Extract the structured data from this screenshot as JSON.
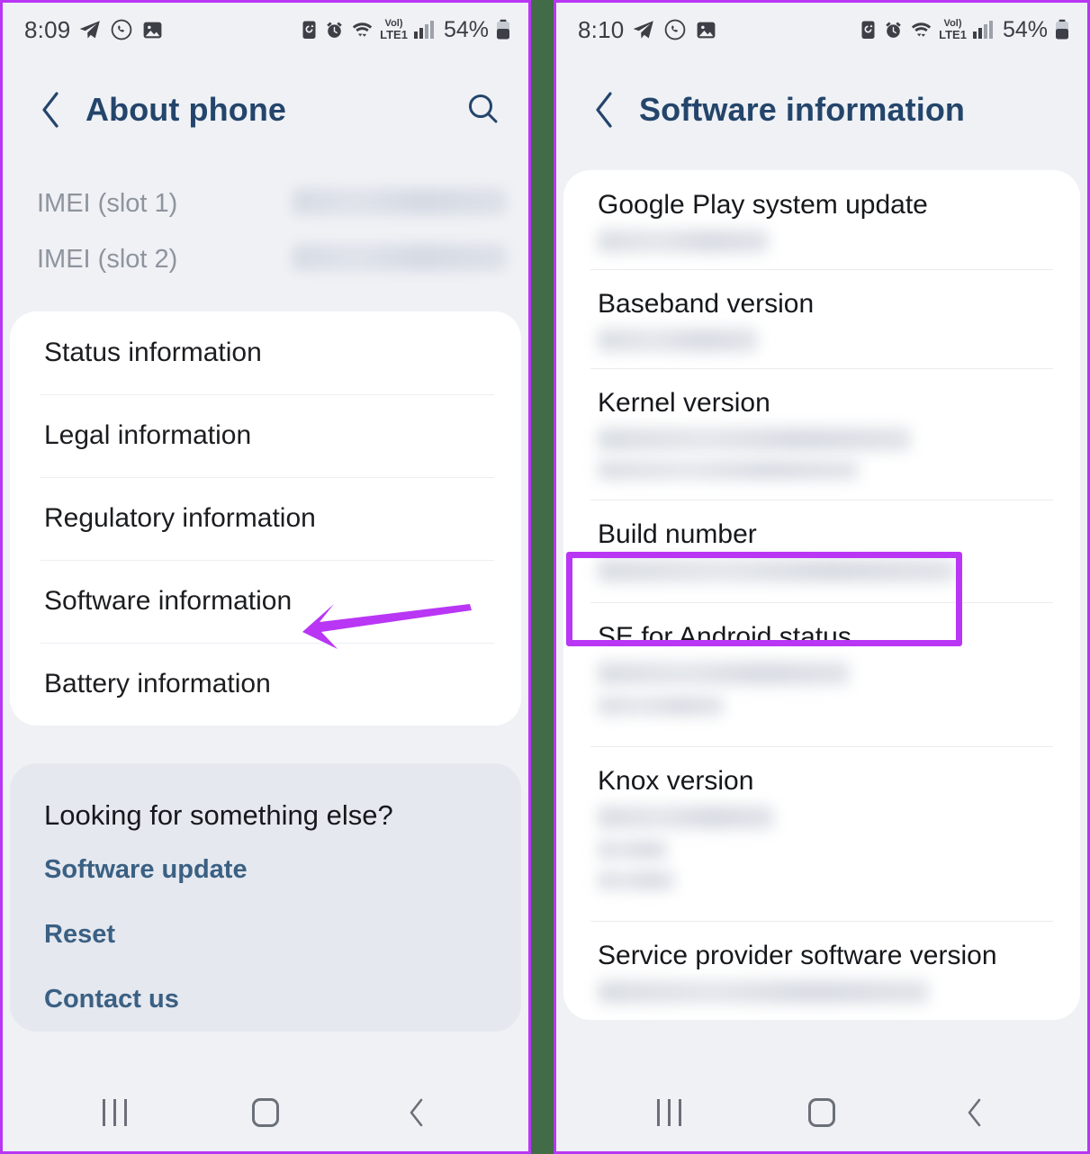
{
  "left_phone": {
    "status_bar": {
      "time": "8:09",
      "battery_percent": "54%",
      "network_label": "LTE1",
      "volte_label": "Vol)",
      "icons": [
        "telegram-icon",
        "whatsapp-icon",
        "gallery-icon",
        "battery-saver-icon",
        "alarm-icon",
        "wifi-icon",
        "volte-icon",
        "signal-bars-icon",
        "battery-icon"
      ]
    },
    "header": {
      "title": "About phone",
      "back_icon": "back-chevron-icon",
      "search_icon": "search-icon"
    },
    "imei": [
      {
        "label": "IMEI (slot 1)",
        "value": ""
      },
      {
        "label": "IMEI (slot 2)",
        "value": ""
      }
    ],
    "menu_items": [
      {
        "label": "Status information"
      },
      {
        "label": "Legal information"
      },
      {
        "label": "Regulatory information"
      },
      {
        "label": "Software information"
      },
      {
        "label": "Battery information"
      }
    ],
    "looking_for": {
      "title": "Looking for something else?",
      "links": [
        {
          "label": "Software update"
        },
        {
          "label": "Reset"
        },
        {
          "label": "Contact us"
        }
      ]
    },
    "nav_bar": {
      "recents_icon": "recents-icon",
      "home_icon": "home-icon",
      "back_icon": "back-icon"
    }
  },
  "right_phone": {
    "status_bar": {
      "time": "8:10",
      "battery_percent": "54%",
      "network_label": "LTE1",
      "volte_label": "Vol)"
    },
    "header": {
      "title": "Software information",
      "back_icon": "back-chevron-icon"
    },
    "info_rows": [
      {
        "label": "Google Play system update",
        "value": ""
      },
      {
        "label": "Baseband version",
        "value": ""
      },
      {
        "label": "Kernel version",
        "value": ""
      },
      {
        "label": "Build number",
        "value": "",
        "highlighted": true
      },
      {
        "label": "SE for Android status",
        "value": ""
      },
      {
        "label": "Knox version",
        "value": ""
      },
      {
        "label": "Service provider software version",
        "value": ""
      }
    ],
    "nav_bar": {
      "recents_icon": "recents-icon",
      "home_icon": "home-icon",
      "back_icon": "back-icon"
    }
  },
  "annotations": {
    "arrow_color": "#b936f5",
    "highlight_color": "#b936f5",
    "panel_border_color": "#b936f5",
    "divider_color": "#426b47",
    "arrow_target": "Software information",
    "highlight_target": "Build number"
  }
}
